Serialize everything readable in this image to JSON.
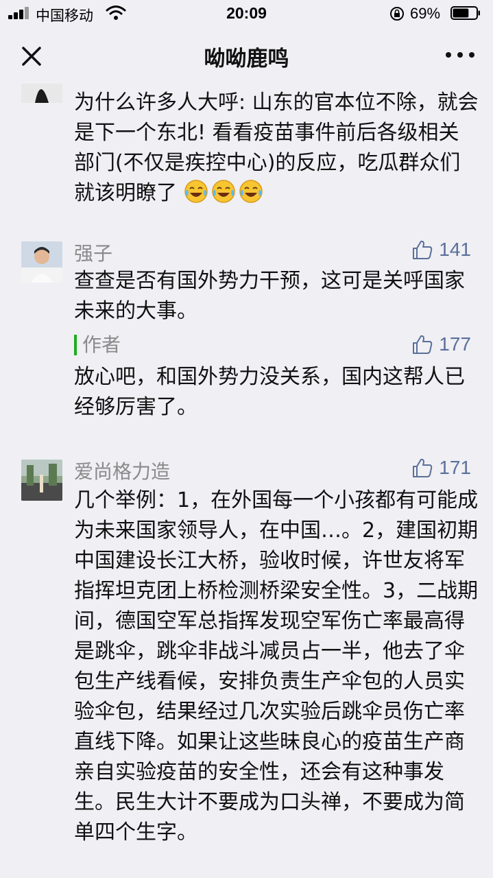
{
  "status_bar": {
    "carrier": "中国移动",
    "time": "20:09",
    "battery_percent": "69%",
    "battery_level": 0.69
  },
  "nav": {
    "title": "呦呦鹿鸣"
  },
  "comments": [
    {
      "nickname": "",
      "text": "为什么许多人大呼: 山东的官本位不除，就会是下一个东北! 看看疫苗事件前后各级相关部门(不仅是疾控中心)的反应，吃瓜群众们就该明瞭了",
      "emoji_count": 3,
      "emoji_icon": "laugh-cry-emoji"
    },
    {
      "nickname": "强子",
      "likes": "141",
      "text": "查查是否有国外势力干预，这可是关呼国家未来的大事。",
      "reply": {
        "author_label": "作者",
        "likes": "177",
        "text": "放心吧，和国外势力没关系，国内这帮人已经够厉害了。"
      }
    },
    {
      "nickname": "爱尚格力造",
      "likes": "171",
      "text": "几个举例：1，在外国每一个小孩都有可能成为未来国家领导人，在中国…。2，建国初期中国建设长江大桥，验收时候，许世友将军指挥坦克团上桥检测桥梁安全性。3，二战期间，德国空军总指挥发现空军伤亡率最高得是跳伞，跳伞非战斗减员占一半，他去了伞包生产线看候，安排负责生产伞包的人员实验伞包，结果经过几次实验后跳伞员伤亡率直线下降。如果让这些昧良心的疫苗生产商亲自实验疫苗的安全性，还会有这种事发生。民生大计不要成为口头禅，不要成为简单四个生字。"
    }
  ],
  "colors": {
    "background": "#efeff4",
    "nickname": "#8a8a8a",
    "like_blue": "#5a6f99",
    "author_green": "#1aad19"
  }
}
